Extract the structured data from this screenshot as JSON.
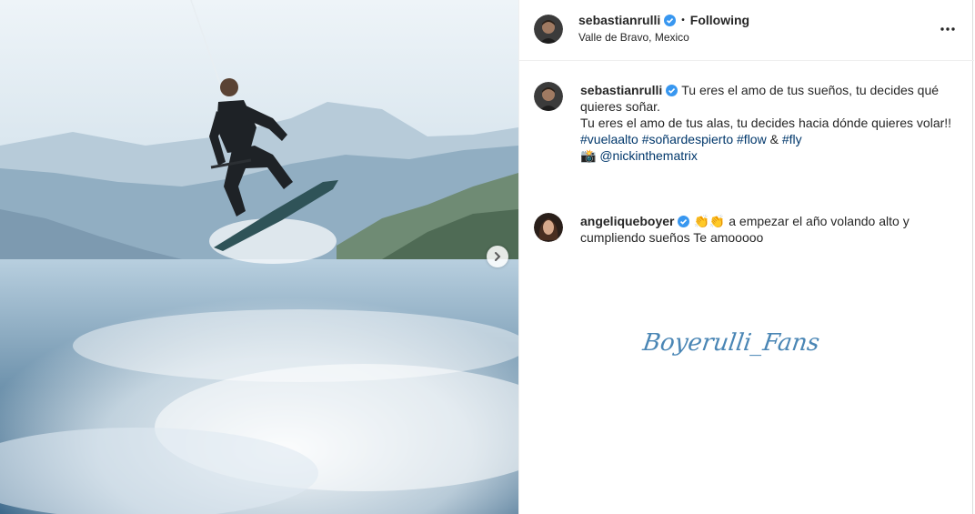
{
  "post": {
    "username": "sebastianrulli",
    "separator": "•",
    "follow_status": "Following",
    "location": "Valle de Bravo, Mexico"
  },
  "caption": {
    "username": "sebastianrulli",
    "line1": "Tu eres el amo de tus sueños, tu decides qué quieres soñar.",
    "line2": "Tu eres el amo de tus alas, tu decides hacia dónde quieres volar!!",
    "hashtags": [
      "#vuelaalto",
      "#soñardespierto",
      "#flow",
      "#fly"
    ],
    "amp": "&",
    "camera_emoji": "📸",
    "mention": "@nickinthematrix"
  },
  "comment": {
    "username": "angeliqueboyer",
    "emoji": "👏👏",
    "text": "a empezar el año volando alto y cumpliendo sueños Te amooooo"
  },
  "watermark": "Boyerulli_Fans",
  "icons": {
    "verified": "verified-badge-icon",
    "more": "more-options-icon",
    "next": "chevron-right-icon"
  },
  "colors": {
    "verified_blue": "#3897f0",
    "link_blue": "#00376b",
    "text": "#262626",
    "watermark": "#4a86b5"
  }
}
